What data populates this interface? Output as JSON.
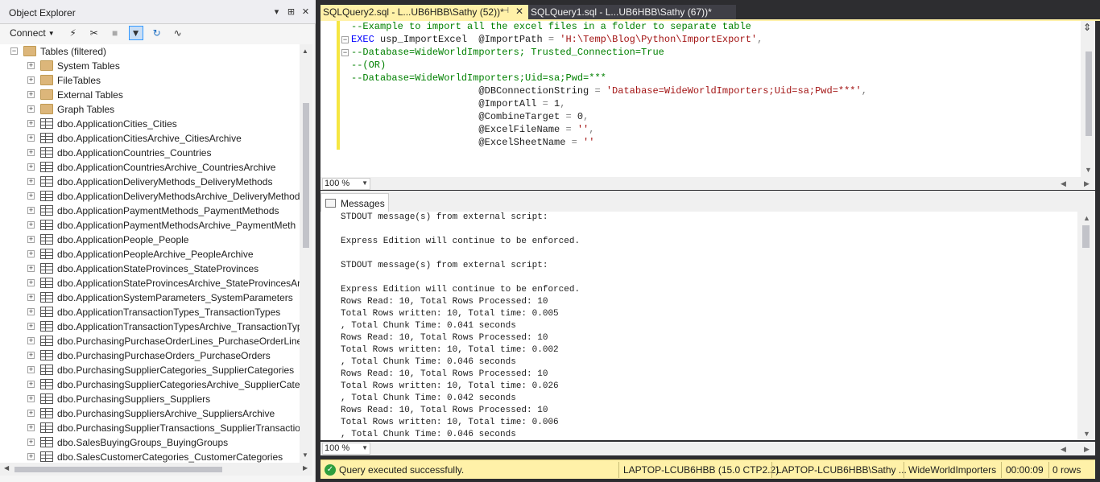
{
  "object_explorer": {
    "title": "Object Explorer",
    "title_buttons": [
      "▾",
      "⊞",
      "✕"
    ],
    "connect_label": "Connect",
    "tree": {
      "root": "Tables (filtered)",
      "folders": [
        "System Tables",
        "FileTables",
        "External Tables",
        "Graph Tables"
      ],
      "tables": [
        "dbo.ApplicationCities_Cities",
        "dbo.ApplicationCitiesArchive_CitiesArchive",
        "dbo.ApplicationCountries_Countries",
        "dbo.ApplicationCountriesArchive_CountriesArchive",
        "dbo.ApplicationDeliveryMethods_DeliveryMethods",
        "dbo.ApplicationDeliveryMethodsArchive_DeliveryMethod",
        "dbo.ApplicationPaymentMethods_PaymentMethods",
        "dbo.ApplicationPaymentMethodsArchive_PaymentMeth",
        "dbo.ApplicationPeople_People",
        "dbo.ApplicationPeopleArchive_PeopleArchive",
        "dbo.ApplicationStateProvinces_StateProvinces",
        "dbo.ApplicationStateProvincesArchive_StateProvincesArc",
        "dbo.ApplicationSystemParameters_SystemParameters",
        "dbo.ApplicationTransactionTypes_TransactionTypes",
        "dbo.ApplicationTransactionTypesArchive_TransactionTyp",
        "dbo.PurchasingPurchaseOrderLines_PurchaseOrderLines",
        "dbo.PurchasingPurchaseOrders_PurchaseOrders",
        "dbo.PurchasingSupplierCategories_SupplierCategories",
        "dbo.PurchasingSupplierCategoriesArchive_SupplierCateg",
        "dbo.PurchasingSuppliers_Suppliers",
        "dbo.PurchasingSuppliersArchive_SuppliersArchive",
        "dbo.PurchasingSupplierTransactions_SupplierTransaction",
        "dbo.SalesBuyingGroups_BuyingGroups",
        "dbo.SalesCustomerCategories_CustomerCategories"
      ]
    }
  },
  "tabs": [
    {
      "label": "SQLQuery2.sql - L...UB6HBB\\Sathy (52))*",
      "active": true
    },
    {
      "label": "SQLQuery1.sql - L...UB6HBB\\Sathy (67))*",
      "active": false
    }
  ],
  "editor": {
    "lines": [
      {
        "parts": [
          {
            "t": "--Example to import all the excel files in a folder to separate table",
            "c": "green"
          }
        ]
      },
      {
        "parts": [
          {
            "t": "EXEC",
            "c": "blue"
          },
          {
            "t": " usp_ImportExcel  @ImportPath ",
            "c": "black"
          },
          {
            "t": "=",
            "c": "gray"
          },
          {
            "t": " 'H:\\Temp\\Blog\\Python\\ImportExport'",
            "c": "red"
          },
          {
            "t": ",",
            "c": "gray"
          }
        ]
      },
      {
        "parts": [
          {
            "t": "--Database=WideWorldImporters; Trusted_Connection=True",
            "c": "green"
          }
        ]
      },
      {
        "parts": [
          {
            "t": "--(OR)",
            "c": "green"
          }
        ]
      },
      {
        "parts": [
          {
            "t": "--Database=WideWorldImporters;Uid=sa;Pwd=***",
            "c": "green"
          }
        ]
      },
      {
        "parts": [
          {
            "t": "                      @DBConnectionString ",
            "c": "black"
          },
          {
            "t": "=",
            "c": "gray"
          },
          {
            "t": " 'Database=WideWorldImporters;Uid=sa;Pwd=***'",
            "c": "red"
          },
          {
            "t": ",",
            "c": "gray"
          }
        ]
      },
      {
        "parts": [
          {
            "t": "                      @ImportAll ",
            "c": "black"
          },
          {
            "t": "=",
            "c": "gray"
          },
          {
            "t": " 1",
            "c": "black"
          },
          {
            "t": ",",
            "c": "gray"
          }
        ]
      },
      {
        "parts": [
          {
            "t": "                      @CombineTarget ",
            "c": "black"
          },
          {
            "t": "=",
            "c": "gray"
          },
          {
            "t": " 0",
            "c": "black"
          },
          {
            "t": ",",
            "c": "gray"
          }
        ]
      },
      {
        "parts": [
          {
            "t": "                      @ExcelFileName ",
            "c": "black"
          },
          {
            "t": "=",
            "c": "gray"
          },
          {
            "t": " ''",
            "c": "red"
          },
          {
            "t": ",",
            "c": "gray"
          }
        ]
      },
      {
        "parts": [
          {
            "t": "                      @ExcelSheetName ",
            "c": "black"
          },
          {
            "t": "=",
            "c": "gray"
          },
          {
            "t": " ''",
            "c": "red"
          }
        ]
      }
    ],
    "zoom": "100 %"
  },
  "results": {
    "tab_label": "Messages",
    "zoom": "100 %",
    "lines": [
      "STDOUT message(s) from external script:",
      "",
      "Express Edition will continue to be enforced.",
      "",
      "STDOUT message(s) from external script:",
      "",
      "Express Edition will continue to be enforced.",
      "Rows Read: 10, Total Rows Processed: 10",
      "Total Rows written: 10, Total time: 0.005",
      ", Total Chunk Time: 0.041 seconds",
      "Rows Read: 10, Total Rows Processed: 10",
      "Total Rows written: 10, Total time: 0.002",
      ", Total Chunk Time: 0.046 seconds",
      "Rows Read: 10, Total Rows Processed: 10",
      "Total Rows written: 10, Total time: 0.026",
      ", Total Chunk Time: 0.042 seconds",
      "Rows Read: 10, Total Rows Processed: 10",
      "Total Rows written: 10, Total time: 0.006",
      ", Total Chunk Time: 0.046 seconds"
    ]
  },
  "status_bar": {
    "message": "Query executed successfully.",
    "server": "LAPTOP-LCUB6HBB (15.0 CTP2.2)",
    "user": "LAPTOP-LCUB6HBB\\Sathy ...",
    "database": "WideWorldImporters",
    "elapsed": "00:00:09",
    "rows": "0 rows"
  },
  "colors": {
    "active_tab": "#fff1a8",
    "status_bar": "#fff1a8",
    "success": "#2e9e3e"
  }
}
